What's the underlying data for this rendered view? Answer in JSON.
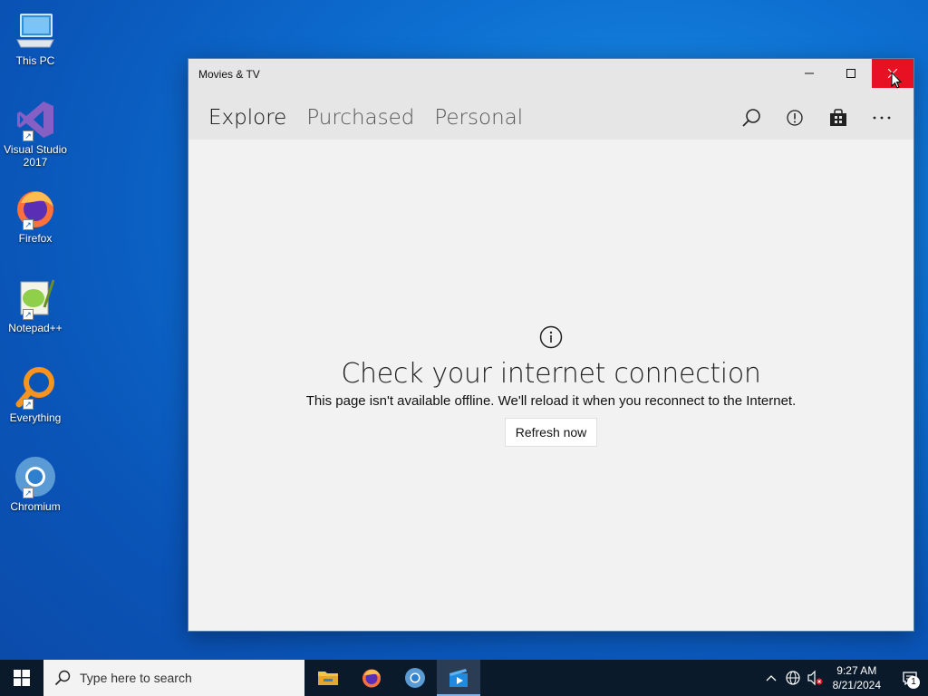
{
  "desktop": {
    "icons": [
      {
        "label": "This PC",
        "icon": "computer-icon"
      },
      {
        "label": "Visual Studio 2017",
        "icon": "visual-studio-icon"
      },
      {
        "label": "Firefox",
        "icon": "firefox-icon"
      },
      {
        "label": "Notepad++",
        "icon": "notepadpp-icon"
      },
      {
        "label": "Everything",
        "icon": "everything-search-icon"
      },
      {
        "label": "Chromium",
        "icon": "chromium-icon"
      }
    ]
  },
  "window": {
    "title": "Movies & TV",
    "controls": {
      "minimize": "—",
      "maximize": "☐",
      "close": "✕"
    },
    "tabs": [
      {
        "label": "Explore",
        "active": true
      },
      {
        "label": "Purchased",
        "active": false
      },
      {
        "label": "Personal",
        "active": false
      }
    ],
    "nav_icons": [
      "search-icon",
      "alert-icon",
      "store-bag-icon",
      "more-icon"
    ],
    "message": {
      "heading": "Check your internet connection",
      "body": "This page isn't available offline. We'll reload it when you reconnect to the Internet.",
      "button": "Refresh now"
    }
  },
  "taskbar": {
    "search_placeholder": "Type here to search",
    "apps": [
      "file-explorer-icon",
      "firefox-icon",
      "chromium-icon",
      "movies-tv-icon"
    ],
    "active_app": "movies-tv-icon",
    "clock": {
      "time": "9:27 AM",
      "date": "8/21/2024"
    },
    "notification_count": "1"
  },
  "colors": {
    "accent": "#0063b1",
    "close_red": "#e81123",
    "taskbar": "#0b1a2b"
  }
}
